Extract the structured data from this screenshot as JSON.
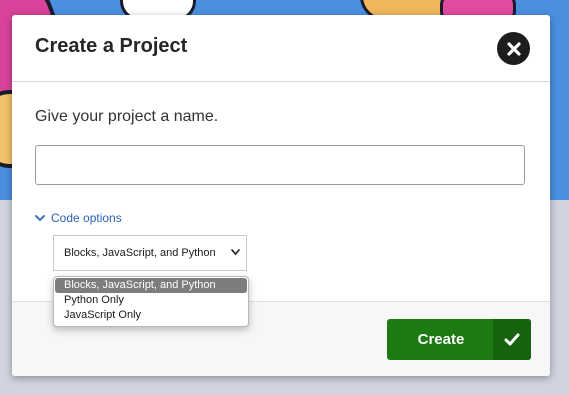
{
  "dialog": {
    "title": "Create a Project",
    "close_icon": "close-icon",
    "prompt": "Give your project a name.",
    "name_input": {
      "value": "",
      "placeholder": ""
    },
    "code_options": {
      "label": "Code options",
      "icon": "chevron-down-icon",
      "expanded": true
    },
    "language_select": {
      "selected": "Blocks, JavaScript, and Python",
      "options": [
        "Blocks, JavaScript, and Python",
        "Python Only",
        "JavaScript Only"
      ]
    },
    "create_button": {
      "label": "Create",
      "icon": "checkmark-icon"
    }
  },
  "colors": {
    "accent_link": "#2a63b0",
    "create_button": "#1d7a12",
    "close_button": "#1d1d1d"
  }
}
